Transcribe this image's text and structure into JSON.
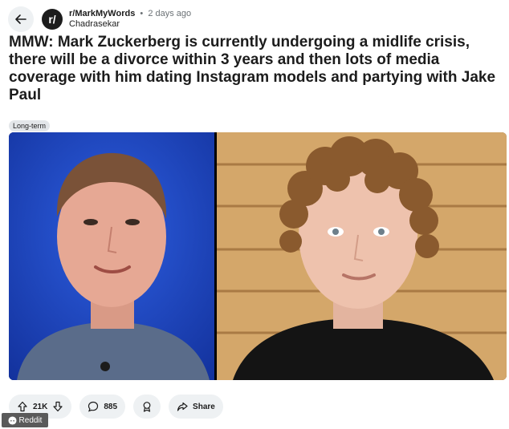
{
  "header": {
    "subreddit": "r/MarkMyWords",
    "separator": "•",
    "time": "2 days ago",
    "username": "Chadrasekar",
    "avatar_letter": "r/"
  },
  "post": {
    "title": "MMW: Mark Zuckerberg is currently undergoing a midlife crisis, there will be a divorce within 3 years and then lots of media coverage with him dating Instagram models and partying with Jake Paul",
    "flair": "Long-term"
  },
  "actions": {
    "votes": "21K",
    "comments": "885",
    "share_label": "Share"
  },
  "watermark": {
    "label": "Reddit"
  },
  "colors": {
    "left_photo_bg": "#1a3fae",
    "right_photo_bg": "#c99a5a",
    "pill_bg": "#eef1f3"
  },
  "icons": [
    "back-arrow-icon",
    "upvote-icon",
    "downvote-icon",
    "comment-icon",
    "award-icon",
    "share-icon",
    "reddit-logo-icon"
  ]
}
